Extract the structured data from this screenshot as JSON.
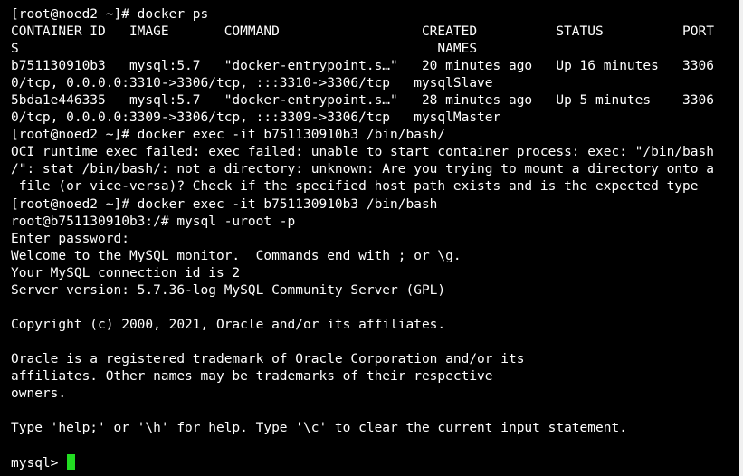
{
  "terminal": {
    "lines": [
      "[root@noed2 ~]# docker ps",
      "CONTAINER ID   IMAGE       COMMAND                  CREATED          STATUS          PORT",
      "S                                                     NAMES",
      "b751130910b3   mysql:5.7   \"docker-entrypoint.s…\"   20 minutes ago   Up 16 minutes   3306",
      "0/tcp, 0.0.0.0:3310->3306/tcp, :::3310->3306/tcp   mysqlSlave",
      "5bda1e446335   mysql:5.7   \"docker-entrypoint.s…\"   28 minutes ago   Up 5 minutes    3306",
      "0/tcp, 0.0.0.0:3309->3306/tcp, :::3309->3306/tcp   mysqlMaster",
      "[root@noed2 ~]# docker exec -it b751130910b3 /bin/bash/",
      "OCI runtime exec failed: exec failed: unable to start container process: exec: \"/bin/bash",
      "/\": stat /bin/bash/: not a directory: unknown: Are you trying to mount a directory onto a",
      " file (or vice-versa)? Check if the specified host path exists and is the expected type",
      "[root@noed2 ~]# docker exec -it b751130910b3 /bin/bash",
      "root@b751130910b3:/# mysql -uroot -p",
      "Enter password:",
      "Welcome to the MySQL monitor.  Commands end with ; or \\g.",
      "Your MySQL connection id is 2",
      "Server version: 5.7.36-log MySQL Community Server (GPL)",
      "",
      "Copyright (c) 2000, 2021, Oracle and/or its affiliates.",
      "",
      "Oracle is a registered trademark of Oracle Corporation and/or its",
      "affiliates. Other names may be trademarks of their respective",
      "owners.",
      "",
      "Type 'help;' or '\\h' for help. Type '\\c' to clear the current input statement.",
      ""
    ],
    "prompt": "mysql> "
  },
  "colors": {
    "background": "#000000",
    "text": "#ffffff",
    "cursor": "#22dd22"
  }
}
